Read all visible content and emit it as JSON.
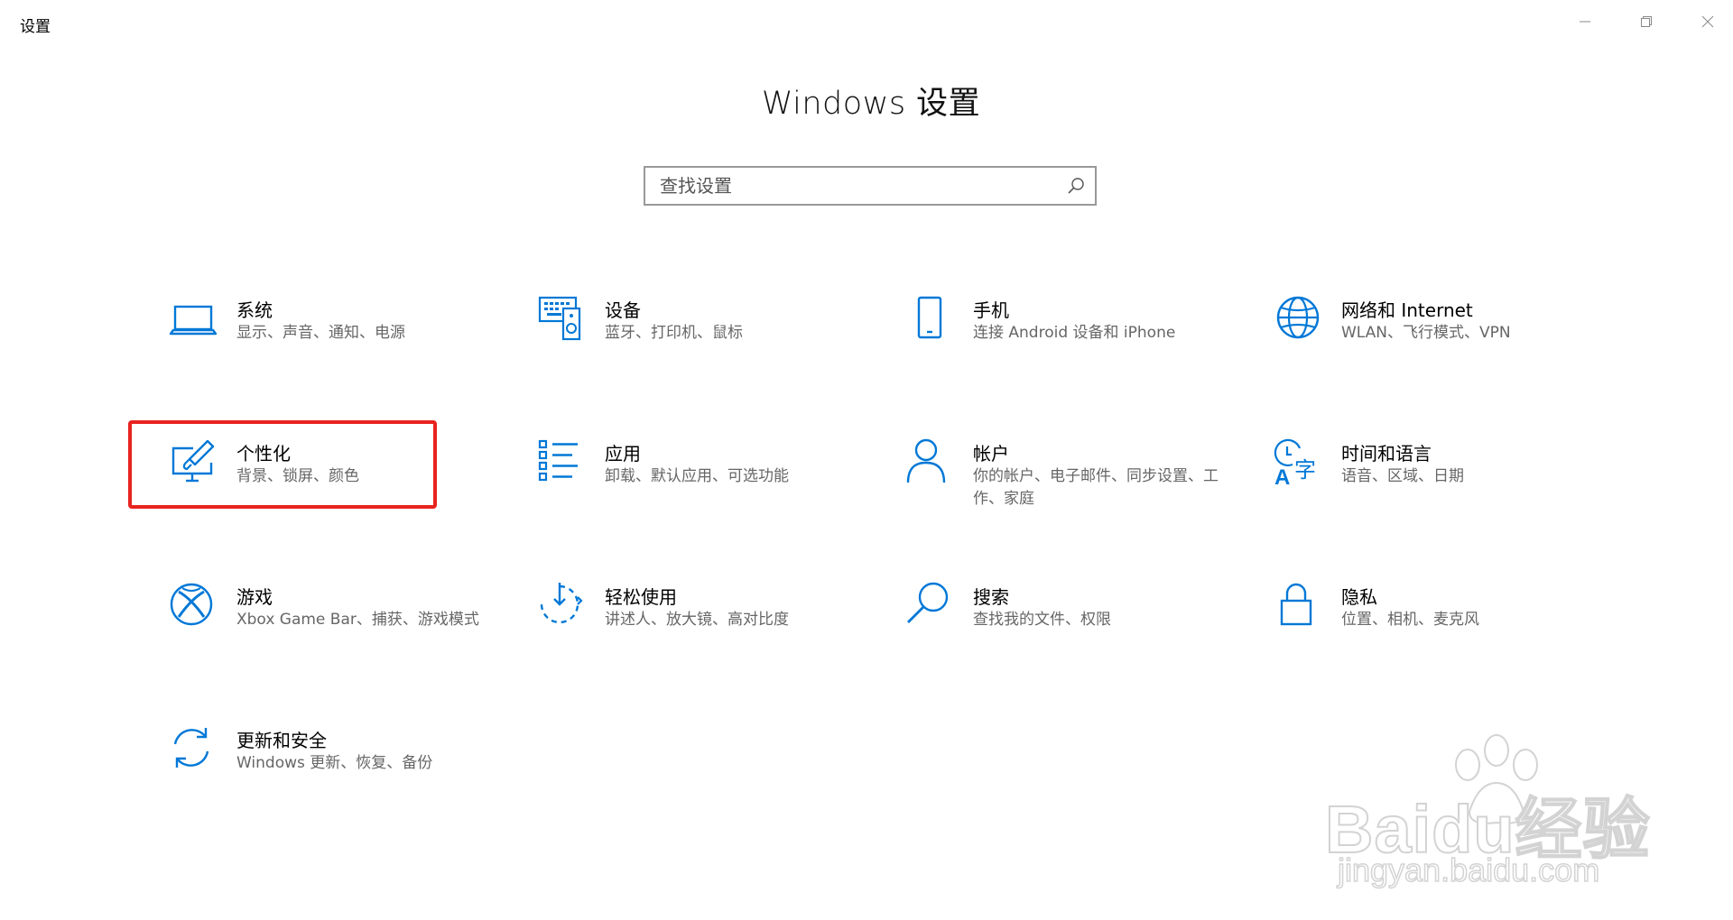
{
  "window": {
    "title": "设置"
  },
  "page": {
    "title": "Windows 设置"
  },
  "search": {
    "placeholder": "查找设置"
  },
  "tiles": [
    {
      "title": "系统",
      "subtitle": "显示、声音、通知、电源",
      "icon": "laptop-icon"
    },
    {
      "title": "设备",
      "subtitle": "蓝牙、打印机、鼠标",
      "icon": "devices-icon"
    },
    {
      "title": "手机",
      "subtitle": "连接 Android 设备和 iPhone",
      "icon": "phone-icon"
    },
    {
      "title": "网络和 Internet",
      "subtitle": "WLAN、飞行模式、VPN",
      "icon": "globe-icon"
    },
    {
      "title": "个性化",
      "subtitle": "背景、锁屏、颜色",
      "icon": "personalization-icon"
    },
    {
      "title": "应用",
      "subtitle": "卸载、默认应用、可选功能",
      "icon": "apps-list-icon"
    },
    {
      "title": "帐户",
      "subtitle": "你的帐户、电子邮件、同步设置、工作、家庭",
      "icon": "person-icon"
    },
    {
      "title": "时间和语言",
      "subtitle": "语音、区域、日期",
      "icon": "time-language-icon"
    },
    {
      "title": "游戏",
      "subtitle": "Xbox Game Bar、捕获、游戏模式",
      "icon": "xbox-icon"
    },
    {
      "title": "轻松使用",
      "subtitle": "讲述人、放大镜、高对比度",
      "icon": "ease-of-access-icon"
    },
    {
      "title": "搜索",
      "subtitle": "查找我的文件、权限",
      "icon": "search-magnifier-icon"
    },
    {
      "title": "隐私",
      "subtitle": "位置、相机、麦克风",
      "icon": "lock-icon"
    },
    {
      "title": "更新和安全",
      "subtitle": "Windows 更新、恢复、备份",
      "icon": "update-sync-icon"
    }
  ],
  "watermark": {
    "brand": "Baidu经验",
    "url": "jingyan.baidu.com"
  },
  "colors": {
    "accent": "#0078d7",
    "highlight": "#e8231f"
  }
}
